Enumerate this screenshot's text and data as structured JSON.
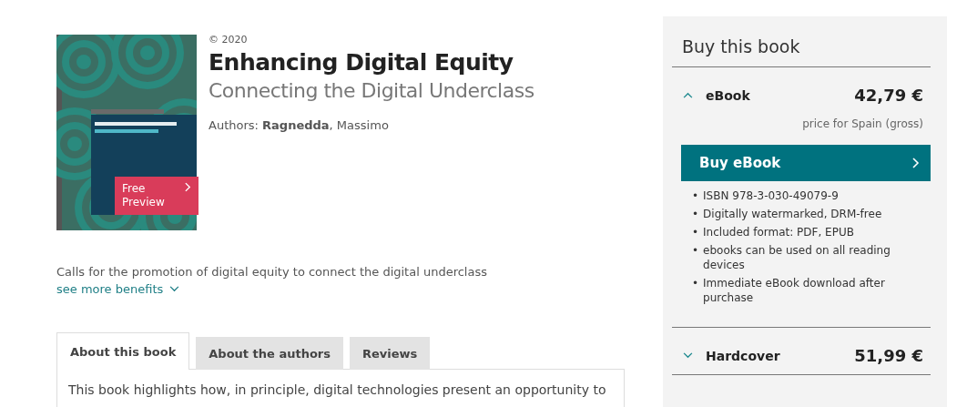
{
  "book": {
    "preview_button": "Free Preview",
    "copyright": "© 2020",
    "title": "Enhancing Digital Equity",
    "subtitle": "Connecting the Digital Underclass",
    "authors_label": "Authors:",
    "authors": "**Ragnedda**, Massimo"
  },
  "benefit": "Calls for the promotion of digital equity to connect the digital underclass",
  "see_more": "see more benefits",
  "tabs": [
    {
      "label": "About this book",
      "selected": true
    },
    {
      "label": "About the authors",
      "selected": false
    },
    {
      "label": "Reviews",
      "selected": false
    }
  ],
  "tab_text": "This book highlights how, in principle, digital technologies present an opportunity to",
  "buy_box": {
    "title": "Buy this book",
    "options": [
      {
        "format": "eBook",
        "price": "42,79 €",
        "expanded": true,
        "note": "price for Spain (gross)",
        "button": "Buy eBook",
        "bullet": "•",
        "features": [
          "ISBN 978-3-030-49079-9",
          "Digitally watermarked, DRM-free",
          "Included format: PDF, EPUB",
          "ebooks can be used on all reading devices",
          "Immediate eBook download after purchase"
        ]
      },
      {
        "format": "Hardcover",
        "price": "51,99 €",
        "expanded": false
      }
    ]
  }
}
